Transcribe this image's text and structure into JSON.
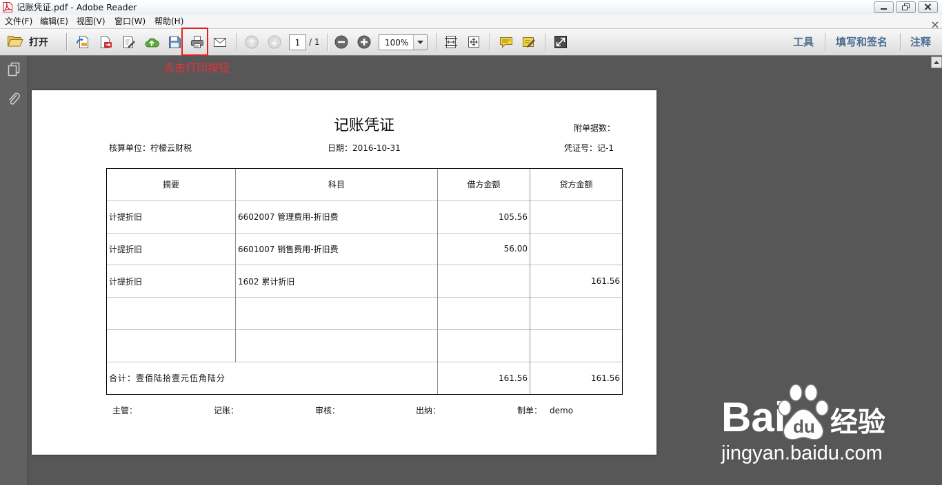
{
  "window": {
    "title": "记账凭证.pdf - Adobe Reader",
    "app_icon": "pdf-file-icon",
    "controls": [
      "minimize-icon",
      "restore-icon",
      "close-icon"
    ]
  },
  "menu": {
    "items": [
      "文件(F)",
      "编辑(E)",
      "视图(V)",
      "窗口(W)",
      "帮助(H)"
    ],
    "close_document_icon": "close-document-icon"
  },
  "toolbar": {
    "open_label": "打开",
    "icons": [
      "folder-open-icon",
      "create-pdf-icon",
      "export-pdf-icon",
      "edit-pdf-icon",
      "cloud-upload-icon",
      "save-icon",
      "print-icon",
      "email-icon",
      "previous-page-icon",
      "next-page-icon",
      "zoom-out-icon",
      "zoom-in-icon",
      "fit-width-icon",
      "fit-page-icon",
      "comment-icon",
      "sign-icon",
      "full-screen-icon"
    ],
    "page_current": "1",
    "page_total": "/ 1",
    "page_nav_disabled": true,
    "zoom_value": "100%",
    "right_links": [
      "工具",
      "填写和签名",
      "注释"
    ]
  },
  "nav_pane": {
    "icons": [
      "pages-icon",
      "attachment-icon"
    ]
  },
  "annotation": {
    "text": "点击打印按钮"
  },
  "document": {
    "title": "记账凭证",
    "attachments_label": "附单据数：",
    "unit_label": "核算单位：柠檬云财税",
    "date_label": "日期：2016-10-31",
    "voucher_no": "凭证号：记-1",
    "table": {
      "headers": [
        "摘要",
        "科目",
        "借方金额",
        "贷方金额"
      ],
      "rows": [
        {
          "summary": "计提折旧",
          "account": "6602007 管理费用-折旧费",
          "debit": "105.56",
          "credit": ""
        },
        {
          "summary": "计提折旧",
          "account": "6601007 销售费用-折旧费",
          "debit": "56.00",
          "credit": ""
        },
        {
          "summary": "计提折旧",
          "account": "1602 累计折旧",
          "debit": "",
          "credit": "161.56"
        },
        {
          "summary": "",
          "account": "",
          "debit": "",
          "credit": ""
        },
        {
          "summary": "",
          "account": "",
          "debit": "",
          "credit": ""
        }
      ],
      "total": {
        "label": "合计：壹佰陆拾壹元伍角陆分",
        "debit": "161.56",
        "credit": "161.56"
      }
    },
    "signatures": {
      "supervisor": "主管：",
      "bookkeeper": "记账：",
      "reviewer": "审核：",
      "cashier": "出纳：",
      "preparer": "制单：",
      "preparer_name": "demo"
    }
  },
  "watermark": {
    "logo_left": "Bai",
    "logo_paw": "du",
    "logo_cn": "经验",
    "url": "jingyan.baidu.com"
  },
  "colors": {
    "workspace_background": "#575757",
    "page_background": "#ffffff",
    "highlight_box": "#e02020",
    "annotation_text": "#e8313a",
    "right_link_text": "#4b6d91"
  }
}
